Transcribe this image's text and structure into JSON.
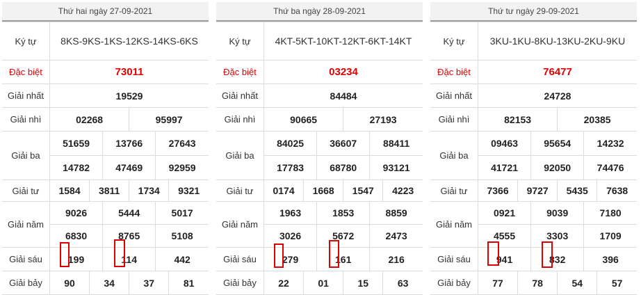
{
  "labels": {
    "ky_tu": "Ký tự",
    "dac_biet": "Đặc biệt",
    "giai_nhat": "Giải nhất",
    "giai_nhi": "Giải nhì",
    "giai_ba": "Giải ba",
    "giai_tu": "Giải tư",
    "giai_nam": "Giải năm",
    "giai_sau": "Giải sáu",
    "giai_bay": "Giải bảy"
  },
  "days": [
    {
      "header": "Thứ hai ngày 27-09-2021",
      "ky_tu": "8KS-9KS-1KS-12KS-14KS-6KS",
      "dac_biet": "73011",
      "giai_nhat": "19529",
      "giai_nhi": [
        "02268",
        "95997"
      ],
      "giai_ba": [
        "51659",
        "13766",
        "27643",
        "14782",
        "47469",
        "92959"
      ],
      "giai_tu": [
        "1584",
        "3811",
        "1734",
        "9321"
      ],
      "giai_nam": [
        "9026",
        "5444",
        "5017",
        "6830",
        "8765",
        "5108"
      ],
      "giai_sau": [
        "199",
        "114",
        "442"
      ],
      "giai_bay": [
        "90",
        "34",
        "37",
        "81"
      ]
    },
    {
      "header": "Thứ ba ngày 28-09-2021",
      "ky_tu": "4KT-5KT-10KT-12KT-6KT-14KT",
      "dac_biet": "03234",
      "giai_nhat": "84484",
      "giai_nhi": [
        "90665",
        "27193"
      ],
      "giai_ba": [
        "84025",
        "36607",
        "88411",
        "17783",
        "68780",
        "93121"
      ],
      "giai_tu": [
        "0174",
        "1668",
        "1547",
        "4223"
      ],
      "giai_nam": [
        "1963",
        "1853",
        "8859",
        "3026",
        "5672",
        "2473"
      ],
      "giai_sau": [
        "279",
        "161",
        "216"
      ],
      "giai_bay": [
        "22",
        "01",
        "15",
        "63"
      ]
    },
    {
      "header": "Thứ tư ngày 29-09-2021",
      "ky_tu": "3KU-1KU-8KU-13KU-2KU-9KU",
      "dac_biet": "76477",
      "giai_nhat": "24728",
      "giai_nhi": [
        "82153",
        "20385"
      ],
      "giai_ba": [
        "09463",
        "95654",
        "14232",
        "41721",
        "92050",
        "74476"
      ],
      "giai_tu": [
        "7366",
        "9727",
        "5435",
        "7638"
      ],
      "giai_nam": [
        "0921",
        "9039",
        "7180",
        "4555",
        "3303",
        "1709"
      ],
      "giai_sau": [
        "941",
        "832",
        "396"
      ],
      "giai_bay": [
        "77",
        "78",
        "54",
        "57"
      ]
    }
  ],
  "colors": {
    "special_prize": "#e00000",
    "highlight_box": "#e00000"
  }
}
